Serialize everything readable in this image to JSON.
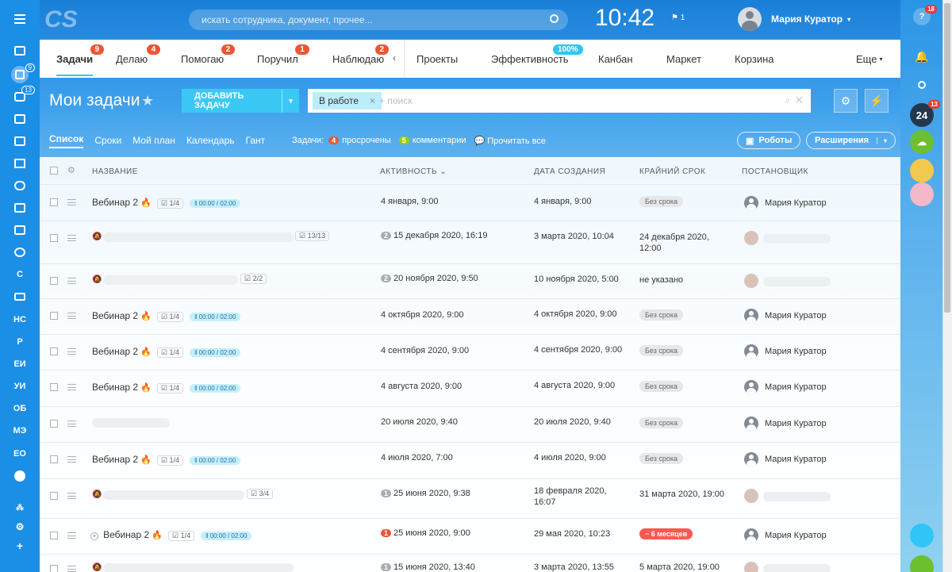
{
  "header": {
    "logo_text": "CS",
    "search_placeholder": "искать сотрудника, документ, прочее...",
    "clock": "10:42",
    "flag_count": "1",
    "user_name": "Мария Куратор"
  },
  "left_sidebar": {
    "chat_counter": "9",
    "messages_counter": "13",
    "items": [
      "С",
      "НС",
      "Р",
      "ЕИ",
      "УИ",
      "ОБ",
      "МЭ",
      "ЕО"
    ]
  },
  "right_sidebar": {
    "help_badge": "18",
    "b24_label": "24",
    "b24_badge": "13"
  },
  "tabs": [
    {
      "label": "Задачи",
      "count": "9"
    },
    {
      "label": "Делаю",
      "count": "4"
    },
    {
      "label": "Помогаю",
      "count": "2"
    },
    {
      "label": "Поручил",
      "count": "1"
    },
    {
      "label": "Наблюдаю",
      "count": "2"
    },
    {
      "label": "Проекты",
      "count": ""
    },
    {
      "label": "Эффективность",
      "count": "100%"
    },
    {
      "label": "Канбан",
      "count": ""
    },
    {
      "label": "Маркет",
      "count": ""
    },
    {
      "label": "Корзина",
      "count": ""
    },
    {
      "label": "Еще",
      "count": ""
    }
  ],
  "title_row": {
    "title": "Мои задачи",
    "add_button": "ДОБАВИТЬ ЗАДАЧУ",
    "filter_chip": "В работе",
    "filter_placeholder": "+ поиск"
  },
  "view_row": {
    "views": [
      "Список",
      "Сроки",
      "Мой план",
      "Календарь",
      "Гант"
    ],
    "counters_label": "Задачи:",
    "overdue_count": "4",
    "overdue_label": "просрочены",
    "comments_count": "5",
    "comments_label": "комментарии",
    "read_all": "Прочитать все",
    "robots": "Роботы",
    "extensions": "Расширения"
  },
  "table": {
    "headers": [
      "НАЗВАНИЕ",
      "АКТИВНОСТЬ",
      "ДАТА СОЗДАНИЯ",
      "КРАЙНИЙ СРОК",
      "ПОСТАНОВЩИК"
    ],
    "rows": [
      {
        "name": "Вебинар 2",
        "checklist": "1/4",
        "timer": "00:00 / 02:00",
        "activity": "4 января, 9:00",
        "activity_count": "",
        "created": "4 января, 9:00",
        "deadline": "Без срока",
        "author": "Мария Куратор"
      },
      {
        "name": "",
        "checklist": "13/13",
        "timer": "",
        "activity": "15 декабря 2020, 16:19",
        "activity_count": "2",
        "created": "3 марта 2020, 10:04",
        "deadline": "24 декабря 2020, 12:00",
        "author": ""
      },
      {
        "name": "",
        "checklist": "2/2",
        "timer": "",
        "activity": "20 ноября 2020, 9:50",
        "activity_count": "2",
        "created": "10 ноября 2020, 5:00",
        "deadline": "не указано",
        "author": ""
      },
      {
        "name": "Вебинар 2",
        "checklist": "1/4",
        "timer": "00:00 / 02:00",
        "activity": "4 октября 2020, 9:00",
        "activity_count": "",
        "created": "4 октября 2020, 9:00",
        "deadline": "Без срока",
        "author": "Мария Куратор"
      },
      {
        "name": "Вебинар 2",
        "checklist": "1/4",
        "timer": "00:00 / 02:00",
        "activity": "4 сентября 2020, 9:00",
        "activity_count": "",
        "created": "4 сентября 2020, 9:00",
        "deadline": "Без срока",
        "author": "Мария Куратор"
      },
      {
        "name": "Вебинар 2",
        "checklist": "1/4",
        "timer": "00:00 / 02:00",
        "activity": "4 августа 2020, 9:00",
        "activity_count": "",
        "created": "4 августа 2020, 9:00",
        "deadline": "Без срока",
        "author": "Мария Куратор"
      },
      {
        "name": "",
        "checklist": "",
        "timer": "",
        "activity": "20 июля 2020, 9:40",
        "activity_count": "",
        "created": "20 июля 2020, 9:40",
        "deadline": "Без срока",
        "author": "Мария Куратор"
      },
      {
        "name": "Вебинар 2",
        "checklist": "1/4",
        "timer": "00:00 / 02:00",
        "activity": "4 июля 2020, 7:00",
        "activity_count": "",
        "created": "4 июля 2020, 9:00",
        "deadline": "Без срока",
        "author": "Мария Куратор"
      },
      {
        "name": "",
        "checklist": "3/4",
        "timer": "",
        "activity": "25 июня 2020, 9:38",
        "activity_count": "1",
        "created": "18 февраля 2020, 16:07",
        "deadline": "31 марта 2020, 19:00",
        "author": ""
      },
      {
        "name": "Вебинар 2",
        "checklist": "1/4",
        "timer": "00:00 / 02:00",
        "activity": "25 июня 2020, 9:00",
        "activity_count": "1",
        "created": "29 мая 2020, 10:23",
        "deadline": "− 6 месяцев",
        "author": "Мария Куратор"
      },
      {
        "name": "",
        "checklist": "",
        "timer": "",
        "activity": "15 июня 2020, 13:40",
        "activity_count": "1",
        "created": "3 марта 2020, 13:55",
        "deadline": "5 марта 2020, 19:00",
        "author": ""
      }
    ]
  }
}
